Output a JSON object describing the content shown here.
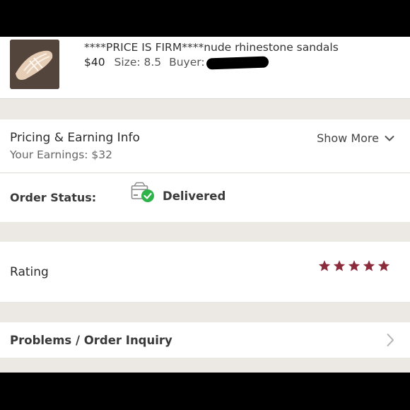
{
  "listing": {
    "title": "****PRICE IS FIRM****nude rhinestone sandals",
    "price": "$40",
    "size": "Size: 8.5",
    "buyer_label": "Buyer:"
  },
  "pricing": {
    "title": "Pricing & Earning Info",
    "earnings": "Your Earnings: $32",
    "show_more": "Show More"
  },
  "order_status": {
    "label": "Order Status:",
    "value": "Delivered"
  },
  "rating": {
    "label": "Rating",
    "stars": 5,
    "star_color": "#8b2a3a"
  },
  "problems": {
    "label": "Problems / Order Inquiry"
  },
  "colors": {
    "section_gap_background": "#ece9e4",
    "delivered_check": "#2eb34a"
  }
}
